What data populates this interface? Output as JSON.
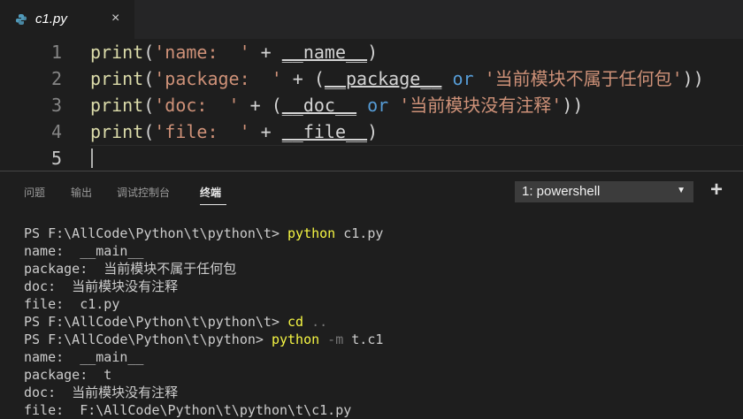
{
  "tab": {
    "title": "c1.py",
    "close": "×"
  },
  "editor": {
    "lines": [
      {
        "num": "1",
        "segs": [
          "print",
          "(",
          "'name:  '",
          " + ",
          "__name__",
          ")"
        ]
      },
      {
        "num": "2",
        "segs": [
          "print",
          "(",
          "'package:  '",
          " + (",
          "__package__",
          " ",
          "or",
          " ",
          "'当前模块不属于任何包'",
          "))"
        ]
      },
      {
        "num": "3",
        "segs": [
          "print",
          "(",
          "'doc:  '",
          " + (",
          "__doc__",
          " ",
          "or",
          " ",
          "'当前模块没有注释'",
          "))"
        ]
      },
      {
        "num": "4",
        "segs": [
          "print",
          "(",
          "'file:  '",
          " + ",
          "__file__",
          ")"
        ]
      },
      {
        "num": "5"
      }
    ]
  },
  "panel": {
    "tabs": [
      "问题",
      "输出",
      "调试控制台",
      "终端"
    ],
    "active_tab": "终端",
    "terminal_select": "1: powershell",
    "add_icon": "+"
  },
  "terminal": {
    "lines": [
      {
        "text": "PS F:\\AllCode\\Python\\t\\python\\t> ",
        "cmd": "python",
        "rest": " c1.py",
        "rest_dim": false
      },
      {
        "text": "name:  __main__"
      },
      {
        "text": "package:  当前模块不属于任何包"
      },
      {
        "text": "doc:  当前模块没有注释"
      },
      {
        "text": "file:  c1.py"
      },
      {
        "text": "PS F:\\AllCode\\Python\\t\\python\\t> ",
        "cmd": "cd",
        "rest": " ..",
        "rest_dim": true
      },
      {
        "text": "PS F:\\AllCode\\Python\\t\\python> ",
        "cmd": "python",
        "dim": " -m",
        "rest": " t.c1",
        "rest_dim": false
      },
      {
        "text": "name:  __main__"
      },
      {
        "text": "package:  t"
      },
      {
        "text": "doc:  当前模块没有注释"
      },
      {
        "text": "file:  F:\\AllCode\\Python\\t\\python\\t\\c1.py"
      }
    ]
  },
  "colors": {
    "background": "#1e1e1e",
    "function": "#dcdcaa",
    "string": "#ce9178",
    "keyword": "#569cd6",
    "terminal_command": "#f5f543"
  }
}
